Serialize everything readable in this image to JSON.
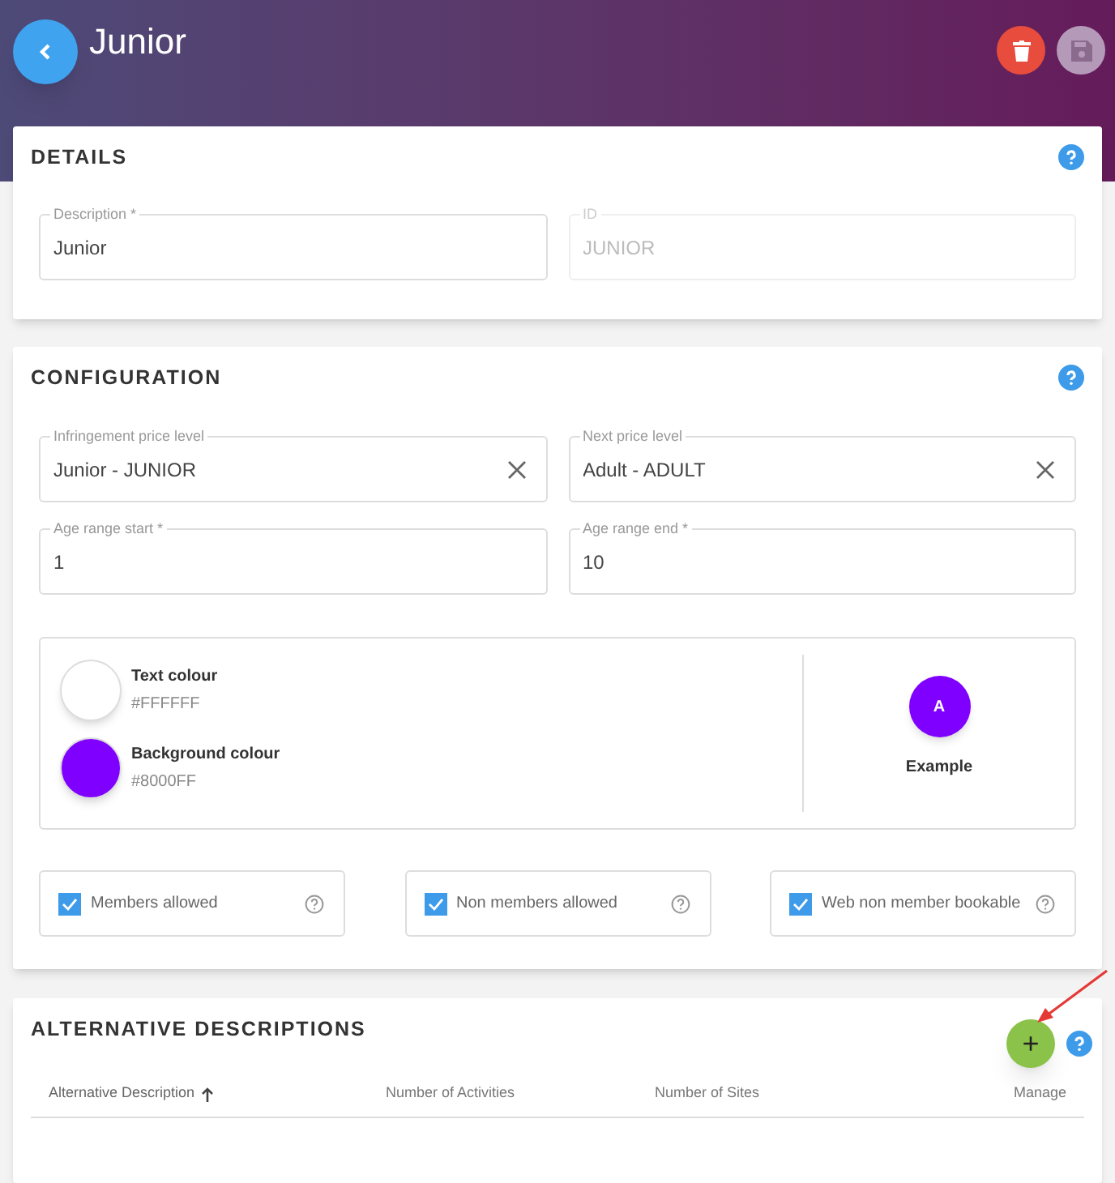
{
  "title": "Junior",
  "details": {
    "heading": "DETAILS",
    "fields": [
      {
        "label": "Description *",
        "value": "Junior",
        "disabled": false
      },
      {
        "label": "ID",
        "value": "JUNIOR",
        "disabled": true
      }
    ]
  },
  "configuration": {
    "heading": "CONFIGURATION",
    "fields": [
      {
        "label": "Infringement price level",
        "value": "Junior - JUNIOR",
        "clearable": true
      },
      {
        "label": "Next price level",
        "value": "Adult - ADULT",
        "clearable": true
      },
      {
        "label": "Age range start *",
        "value": "1",
        "clearable": false
      },
      {
        "label": "Age range end *",
        "value": "10",
        "clearable": false
      }
    ],
    "colours": [
      {
        "label": "Text colour",
        "value": "#FFFFFF",
        "color": "#ffffff"
      },
      {
        "label": "Background colour",
        "value": "#8000FF",
        "color": "#8000ff"
      }
    ],
    "example": {
      "letter": "A",
      "label": "Example"
    },
    "checkboxes": [
      {
        "label": "Members allowed",
        "checked": true
      },
      {
        "label": "Non members allowed",
        "checked": true
      },
      {
        "label": "Web non member bookable",
        "checked": true
      }
    ]
  },
  "alternative": {
    "heading": "ALTERNATIVE DESCRIPTIONS",
    "add_button": "+",
    "columns": [
      {
        "label": "Alternative Description",
        "sorted": true
      },
      {
        "label": "Number of Activities",
        "sorted": false
      },
      {
        "label": "Number of Sites",
        "sorted": false
      },
      {
        "label": "Manage",
        "sorted": false
      }
    ]
  }
}
